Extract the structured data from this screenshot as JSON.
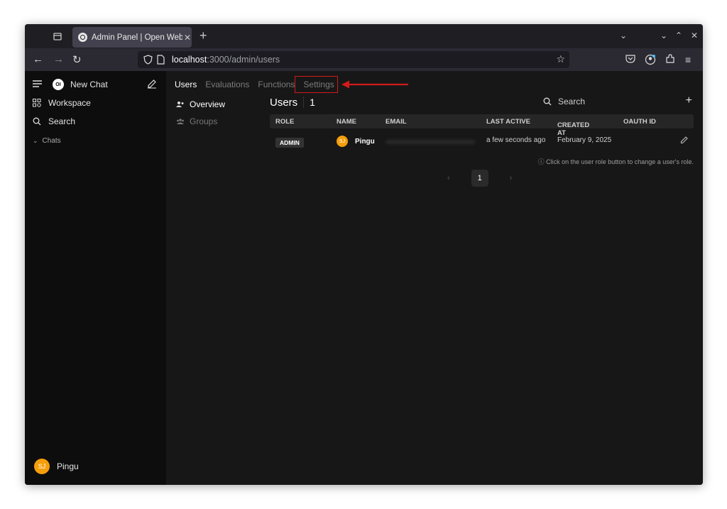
{
  "browser": {
    "tab_title": "Admin Panel | Open WebUI",
    "url_host": "localhost",
    "url_path": ":3000/admin/users"
  },
  "sidebar": {
    "new_chat": "New Chat",
    "logo_text": "OI",
    "workspace": "Workspace",
    "search": "Search",
    "chats": "Chats",
    "user_initials": "SJ",
    "user_name": "Pingu"
  },
  "admin_nav": {
    "tabs": [
      "Users",
      "Evaluations",
      "Functions",
      "Settings"
    ],
    "left_items": [
      "Overview",
      "Groups"
    ]
  },
  "users": {
    "title": "Users",
    "count": "1",
    "search_placeholder": "Search",
    "columns": [
      "ROLE",
      "NAME",
      "EMAIL",
      "LAST ACTIVE",
      "CREATED AT",
      "OAUTH ID"
    ],
    "rows": [
      {
        "role": "ADMIN",
        "initials": "SJ",
        "name": "Pingu",
        "last_active": "a few seconds ago",
        "created_at": "February 9, 2025",
        "oauth_id": ""
      }
    ],
    "hint": "Click on the user role button to change a user's role.",
    "page": "1"
  },
  "colors": {
    "accent_avatar": "#f59e0b",
    "highlight": "#d11a1a"
  }
}
